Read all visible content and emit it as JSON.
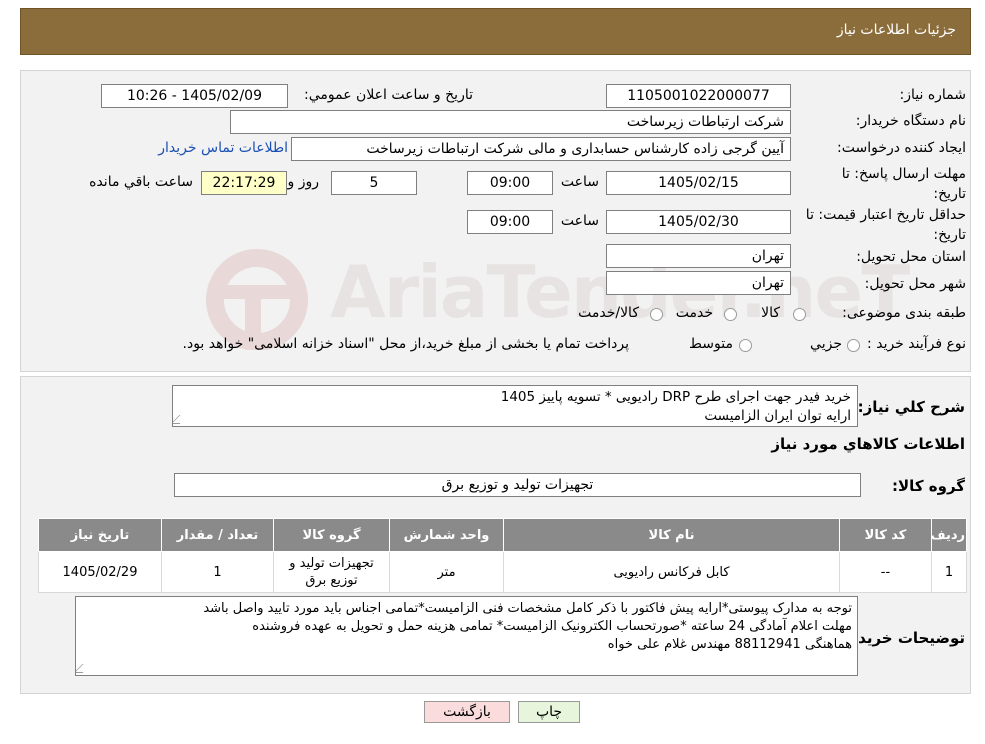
{
  "header": {
    "title": "جزئیات اطلاعات نیاز"
  },
  "watermark": {
    "text": "AriaTender.neT"
  },
  "info": {
    "need_number_label": "شماره نیاز:",
    "need_number": "1105001022000077",
    "announce_label": "تاریخ و ساعت اعلان عمومي:",
    "announce_value": "1405/02/09 - 10:26",
    "buyer_org_label": "نام دستگاه خریدار:",
    "buyer_org": "شرکت ارتباطات زیرساخت",
    "creator_label": "ایجاد کننده درخواست:",
    "creator": "آیین گرجی زاده کارشناس حسابداری و مالی شرکت ارتباطات زیرساخت",
    "contact_link": "اطلاعات تماس خریدار",
    "deadline_label": "مهلت ارسال پاسخ: تا تاریخ:",
    "deadline_date": "1405/02/15",
    "time_label": "ساعت",
    "deadline_time": "09:00",
    "days_value": "5",
    "days_label": "روز و",
    "remaining_time": "22:17:29",
    "remaining_label": "ساعت باقي مانده",
    "validity_label": "حداقل تاریخ اعتبار قیمت: تا تاریخ:",
    "validity_date": "1405/02/30",
    "validity_time": "09:00",
    "province_label": "استان محل تحویل:",
    "province": "تهران",
    "city_label": "شهر محل تحویل:",
    "city": "تهران",
    "category_label": "طبقه بندی موضوعی:",
    "category_options": [
      "کالا",
      "خدمت",
      "کالا/خدمت"
    ],
    "process_label": "نوع فرآیند خرید :",
    "process_options": [
      "جزیي",
      "متوسط"
    ],
    "process_note": "پرداخت تمام یا بخشی از مبلغ خرید،از محل \"اسناد خزانه اسلامی\" خواهد بود."
  },
  "summary": {
    "label": "شرح کلي نياز:",
    "line1": "خرید فیدر جهت اجرای طرح DRP رادیویی  *  تسویه پاییز 1405",
    "line2": "ارایه توان ایران الزامیست"
  },
  "goods": {
    "section_title": "اطلاعات کالاهاي مورد نياز",
    "group_label": "گروه کالا:",
    "group_value": "تجهیزات تولید و توزیع برق",
    "columns": [
      "رديف",
      "کد کالا",
      "نام کالا",
      "واحد شمارش",
      "گروه کالا",
      "تعداد / مقدار",
      "تاریخ نیاز"
    ],
    "rows": [
      {
        "row": "1",
        "code": "--",
        "name": "کابل فرکانس رادیویی",
        "unit": "متر",
        "group": "تجهیزات تولید و توزیع برق",
        "qty": "1",
        "date": "1405/02/29"
      }
    ]
  },
  "notes": {
    "label": "توضیحات خریدار:",
    "line1": "توجه به مدارک پیوستی*ارایه پیش فاکتور با ذکر کامل مشخصات فنی الزامیست*تمامی اجناس باید مورد تایید واصل باشد",
    "line2": "مهلت اعلام آمادگی 24 ساعته *صورتحساب الکترونیک الزامیست* تمامی هزینه حمل و تحویل به عهده فروشنده",
    "line3": "هماهنگی 88112941 مهندس غلام علی خواه"
  },
  "buttons": {
    "print": "چاپ",
    "back": "بازگشت"
  },
  "colors": {
    "header": "#8b6c3b",
    "table_header": "#8a8a8a",
    "print_btn": "#e6f5dc",
    "back_btn": "#fadcdc",
    "link": "#1a4fb5"
  }
}
